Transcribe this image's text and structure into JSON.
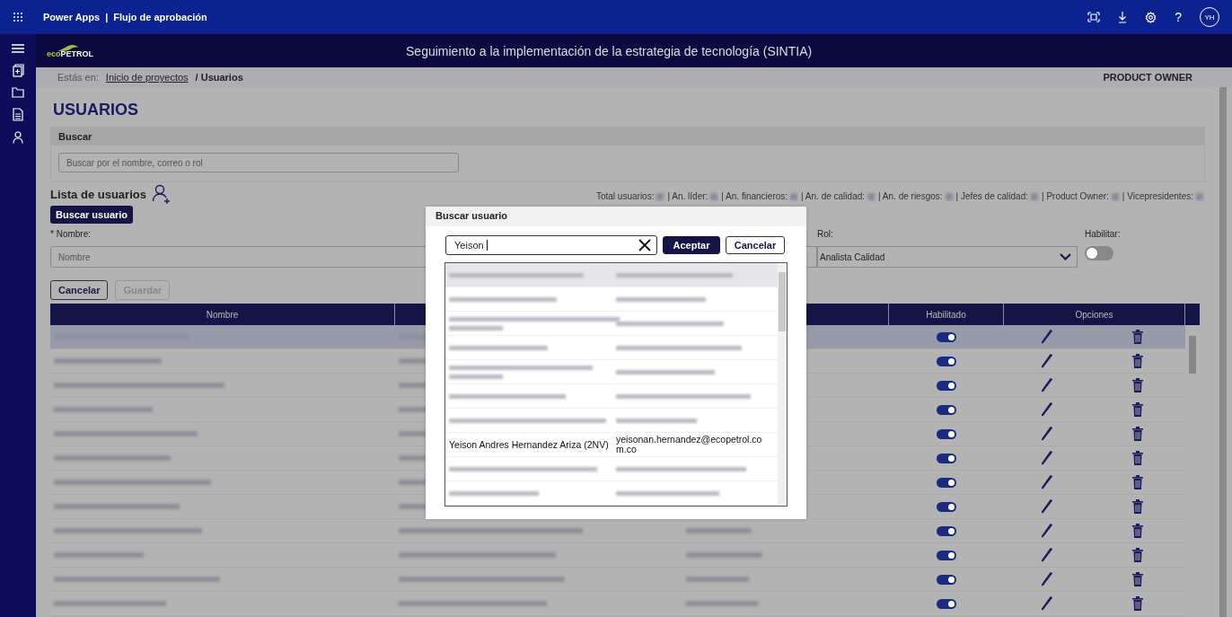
{
  "top_bar": {
    "app": "Power Apps",
    "separator": "|",
    "title": "Flujo de aprobación",
    "help": "?",
    "avatar": "YH"
  },
  "header": {
    "logo": [
      "eco",
      "PETROL"
    ],
    "title": "Seguimiento a la implementación de la estrategia de tecnología (SINTIA)"
  },
  "breadcrumb": {
    "prefix": "Estás en:",
    "link": "Inicio de proyectos",
    "current": "/ Usuarios",
    "role": "PRODUCT OWNER"
  },
  "page_title": "USUARIOS",
  "search_panel": {
    "heading": "Buscar",
    "placeholder": "Buscar por el nombre, correo o rol"
  },
  "list_title": "Lista de usuarios",
  "stats": [
    "Total usuarios:",
    "| An. líder:",
    "| An. financieros:",
    "| An. de calidad:",
    "| An. de riesgos:",
    "| Jefes de calidad:",
    "| Product Owner:",
    "| Vicepresidentes:"
  ],
  "search_user_button": "Buscar usuario",
  "form": {
    "name_label": "* Nombre:",
    "name_placeholder": "Nombre",
    "role_label": "Rol:",
    "role_value": "Analista Calidad",
    "enable_label": "Habilitar:",
    "enabled": false,
    "cancel": "Cancelar",
    "save": "Guardar",
    "save_disabled": true
  },
  "table": {
    "columns": [
      "Nombre",
      "Habilitado",
      "Opciones"
    ],
    "rows": [
      {
        "selected": true,
        "enabled": true
      },
      {
        "selected": false,
        "enabled": true
      },
      {
        "selected": false,
        "enabled": true
      },
      {
        "selected": false,
        "enabled": true
      },
      {
        "selected": false,
        "enabled": true
      },
      {
        "selected": false,
        "enabled": true
      },
      {
        "selected": false,
        "enabled": true
      },
      {
        "selected": false,
        "enabled": true
      },
      {
        "selected": false,
        "enabled": true
      },
      {
        "selected": false,
        "enabled": true
      },
      {
        "selected": false,
        "enabled": true
      },
      {
        "selected": false,
        "enabled": true
      }
    ]
  },
  "dialog": {
    "title": "Buscar usuario",
    "query": "Yeison",
    "accept": "Aceptar",
    "cancel": "Cancelar",
    "results": [
      {
        "kind": "redacted",
        "selected": true
      },
      {
        "kind": "redacted",
        "selected": false
      },
      {
        "kind": "redacted_wrapped",
        "selected": false
      },
      {
        "kind": "redacted",
        "selected": false
      },
      {
        "kind": "redacted_wrapped",
        "selected": false
      },
      {
        "kind": "redacted",
        "selected": false
      },
      {
        "kind": "redacted",
        "selected": false
      },
      {
        "kind": "text",
        "selected": false,
        "name": "Yeison Andres Hernandez Ariza (2NV)",
        "email": "yeisonan.hernandez@ecopetrol.com.co"
      },
      {
        "kind": "redacted",
        "selected": false
      },
      {
        "kind": "redacted",
        "selected": false
      }
    ]
  }
}
